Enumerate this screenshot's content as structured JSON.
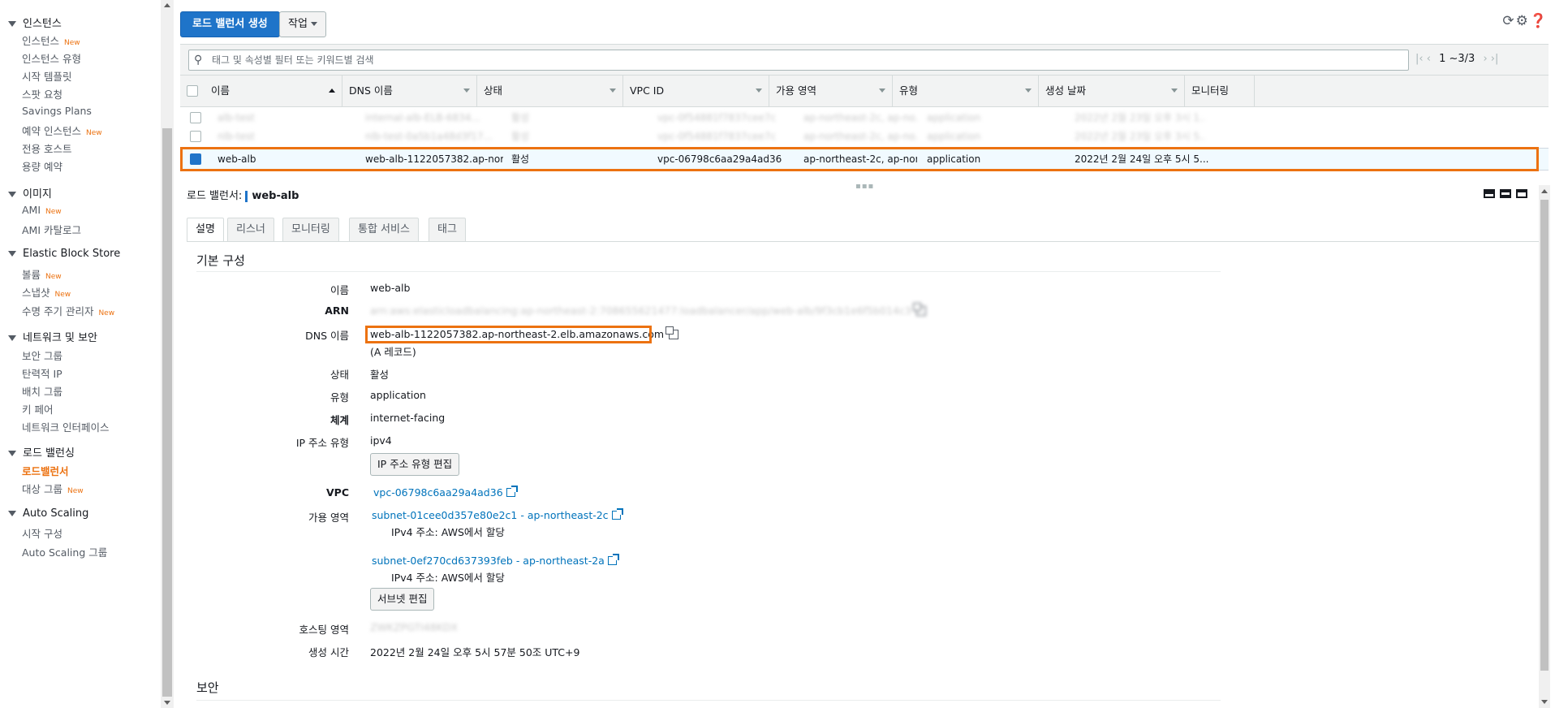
{
  "sidebar": {
    "sections": [
      {
        "title": "인스턴스",
        "items": [
          {
            "label": "인스턴스",
            "badge": "New"
          },
          {
            "label": "인스턴스 유형"
          },
          {
            "label": "시작 템플릿"
          },
          {
            "label": "스팟 요청"
          },
          {
            "label": "Savings Plans"
          },
          {
            "label": "예약 인스턴스",
            "badge": "New"
          },
          {
            "label": "전용 호스트"
          },
          {
            "label": "용량 예약"
          }
        ]
      },
      {
        "title": "이미지",
        "items": [
          {
            "label": "AMI",
            "badge": "New"
          },
          {
            "label": "AMI 카탈로그"
          }
        ]
      },
      {
        "title": "Elastic Block Store",
        "items": [
          {
            "label": "볼륨",
            "badge": "New"
          },
          {
            "label": "스냅샷",
            "badge": "New"
          },
          {
            "label": "수명 주기 관리자",
            "badge": "New"
          }
        ]
      },
      {
        "title": "네트워크 및 보안",
        "items": [
          {
            "label": "보안 그룹"
          },
          {
            "label": "탄력적 IP"
          },
          {
            "label": "배치 그룹"
          },
          {
            "label": "키 페어"
          },
          {
            "label": "네트워크 인터페이스"
          }
        ]
      },
      {
        "title": "로드 밸런싱",
        "items": [
          {
            "label": "로드밸런서",
            "active": true
          },
          {
            "label": "대상 그룹",
            "badge": "New"
          }
        ]
      },
      {
        "title": "Auto Scaling",
        "items": [
          {
            "label": "시작 구성"
          },
          {
            "label": "Auto Scaling 그룹"
          }
        ]
      }
    ]
  },
  "toolbar": {
    "create_label": "로드 밸런서 생성",
    "actions_label": "작업",
    "icons": [
      "refresh-icon",
      "settings-icon",
      "help-icon"
    ]
  },
  "search": {
    "placeholder": "태그 및 속성별 필터 또는 키워드별 검색",
    "pager": "1 ~3/3"
  },
  "table": {
    "columns": [
      "이름",
      "DNS 이름",
      "상태",
      "VPC ID",
      "가용 영역",
      "유형",
      "생성 날짜",
      "모니터링"
    ],
    "rows": [
      {
        "name": "alb-test",
        "dns": "internal-alb-ELB-6834...",
        "state": "활성",
        "vpc": "vpc-0f54881f7837cee7c",
        "az": "ap-northeast-2c, ap-no...",
        "type": "application",
        "created": "2022년 2월 23일 오후 3시 1...",
        "blurred": true
      },
      {
        "name": "nlb-test",
        "dns": "nlb-test-0a5b1a48d3f17...",
        "state": "활성",
        "vpc": "vpc-0f54881f7837cee7c",
        "az": "ap-northeast-2c, ap-no...",
        "type": "application",
        "created": "2022년 2월 23일 오후 3시 5...",
        "blurred": true
      },
      {
        "name": "web-alb",
        "dns": "web-alb-1122057382.ap-nort...",
        "state": "활성",
        "vpc": "vpc-06798c6aa29a4ad36",
        "az": "ap-northeast-2c, ap-nor...",
        "type": "application",
        "created": "2022년 2월 24일 오후 5시 5...",
        "selected": true
      }
    ]
  },
  "detail": {
    "title_prefix": "로드 밸런서:",
    "title_name": "web-alb",
    "tabs": [
      "설명",
      "리스너",
      "모니터링",
      "통합 서비스",
      "태그"
    ],
    "section_title": "기본 구성",
    "fields": {
      "name": {
        "label": "이름",
        "value": "web-alb"
      },
      "arn": {
        "label": "ARN",
        "value": "arn:aws:elasticloadbalancing:ap-northeast-2:708655621477:loadbalancer/app/web-alb/9f3cb1e6f5b014c3"
      },
      "dns": {
        "label": "DNS 이름",
        "value": "web-alb-1122057382.ap-northeast-2.elb.amazonaws.com",
        "note": "(A 레코드)"
      },
      "state": {
        "label": "상태",
        "value": "활성"
      },
      "type": {
        "label": "유형",
        "value": "application"
      },
      "scheme": {
        "label": "체계",
        "value": "internet-facing"
      },
      "ip_type": {
        "label": "IP 주소 유형",
        "value": "ipv4",
        "button": "IP 주소 유형 편집"
      },
      "vpc": {
        "label": "VPC",
        "value": "vpc-06798c6aa29a4ad36"
      },
      "az": {
        "label": "가용 영역",
        "subnets": [
          {
            "subnet": "subnet-01cee0d357e80e2c1 - ap-northeast-2c",
            "ipv4": "IPv4 주소: AWS에서 할당"
          },
          {
            "subnet": "subnet-0ef270cd637393feb - ap-northeast-2a",
            "ipv4": "IPv4 주소: AWS에서 할당"
          }
        ],
        "button": "서브넷 편집"
      },
      "hosted_zone": {
        "label": "호스팅 영역",
        "value": "ZWKZPGTI48KDX"
      },
      "created": {
        "label": "생성 시간",
        "value": "2022년 2월 24일 오후 5시 57분 50조 UTC+9"
      }
    },
    "security_title": "보안"
  },
  "colors": {
    "accent": "#ec7211",
    "primary": "#1f74c9",
    "link": "#0073bb"
  }
}
